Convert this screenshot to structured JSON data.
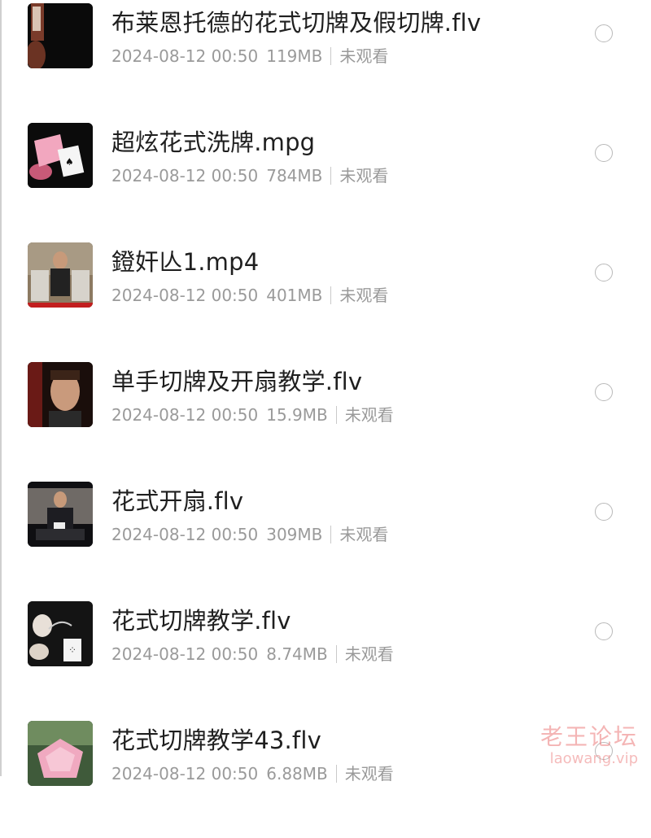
{
  "files": [
    {
      "name": "布莱恩托德的花式切牌及假切牌.flv",
      "date": "2024-08-12 00:50",
      "size": "119MB",
      "status": "未观看",
      "thumb": "card-hand-dark"
    },
    {
      "name": "超炫花式洗牌.mpg",
      "date": "2024-08-12 00:50",
      "size": "784MB",
      "status": "未观看",
      "thumb": "pink-cards"
    },
    {
      "name": "鐙奸亾1.mp4",
      "date": "2024-08-12 00:50",
      "size": "401MB",
      "status": "未观看",
      "thumb": "man-sitting"
    },
    {
      "name": "单手切牌及开扇教学.flv",
      "date": "2024-08-12 00:50",
      "size": "15.9MB",
      "status": "未观看",
      "thumb": "face-closeup"
    },
    {
      "name": "花式开扇.flv",
      "date": "2024-08-12 00:50",
      "size": "309MB",
      "status": "未观看",
      "thumb": "man-table"
    },
    {
      "name": "花式切牌教学.flv",
      "date": "2024-08-12 00:50",
      "size": "8.74MB",
      "status": "未观看",
      "thumb": "hands-cards"
    },
    {
      "name": "花式切牌教学43.flv",
      "date": "2024-08-12 00:50",
      "size": "6.88MB",
      "status": "未观看",
      "thumb": "pink-deck"
    }
  ],
  "watermark": {
    "cn": "老王论坛",
    "en": "laowang.vip"
  },
  "colors": {
    "title": "#1f1f1f",
    "meta": "#9a9a9a",
    "radio": "#b9b9b9",
    "watermark": "#eb7878"
  }
}
